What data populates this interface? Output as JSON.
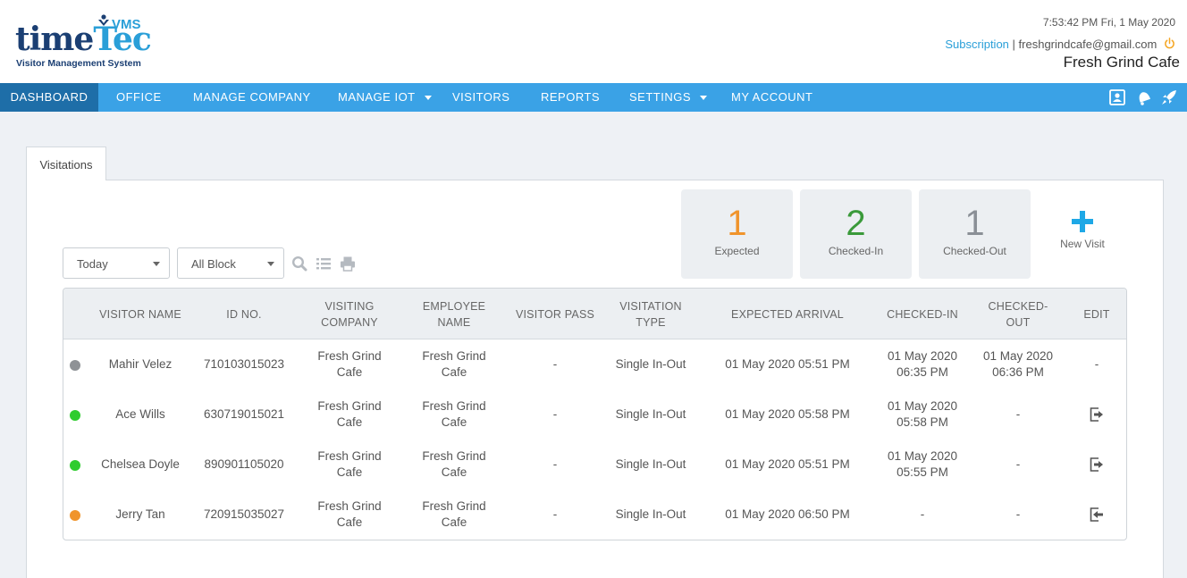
{
  "header": {
    "logo": {
      "time": "time",
      "tec": "Tec",
      "vms": "VMS",
      "subtitle": "Visitor Management System"
    },
    "datetime": "7:53:42 PM  Fri, 1 May 2020",
    "subscription_label": "Subscription",
    "separator": "|",
    "email": "freshgrindcafe@gmail.com",
    "company_name": "Fresh Grind Cafe",
    "power_icon": "power-icon"
  },
  "nav": {
    "items": [
      {
        "label": "DASHBOARD",
        "active": true
      },
      {
        "label": "OFFICE"
      },
      {
        "label": "MANAGE COMPANY"
      },
      {
        "label": "MANAGE IOT",
        "dropdown": true
      },
      {
        "label": "VISITORS"
      },
      {
        "label": "REPORTS"
      },
      {
        "label": "SETTINGS",
        "dropdown": true
      },
      {
        "label": "MY ACCOUNT"
      }
    ],
    "right_icons": [
      "contact-card-icon",
      "bell-icon",
      "rocket-icon"
    ]
  },
  "tab": {
    "label": "Visitations"
  },
  "stats": [
    {
      "value": "1",
      "label": "Expected",
      "color": "#f0942c"
    },
    {
      "value": "2",
      "label": "Checked-In",
      "color": "#3a9a3a"
    },
    {
      "value": "1",
      "label": "Checked-Out",
      "color": "#8a8f96"
    }
  ],
  "new_visit": {
    "label": "New Visit",
    "icon": "plus-icon"
  },
  "filters": {
    "date": "Today",
    "block": "All Block",
    "icons": [
      "search-icon",
      "list-icon",
      "print-icon"
    ]
  },
  "table": {
    "columns": [
      "VISITOR NAME",
      "ID NO.",
      "VISITING COMPANY",
      "EMPLOYEE NAME",
      "VISITOR PASS",
      "VISITATION TYPE",
      "EXPECTED ARRIVAL",
      "CHECKED-IN",
      "CHECKED-OUT",
      "EDIT"
    ],
    "rows": [
      {
        "status_color": "#8f9296",
        "name": "Mahir Velez",
        "id": "710103015023",
        "company": "Fresh Grind Cafe",
        "employee": "Fresh Grind Cafe",
        "pass": "-",
        "type": "Single In-Out",
        "expected": "01 May 2020 05:51 PM",
        "checked_in": "01 May 2020 06:35 PM",
        "checked_out": "01 May 2020 06:36 PM",
        "edit": "-",
        "edit_icon": ""
      },
      {
        "status_color": "#2ecc2e",
        "name": "Ace Wills",
        "id": "630719015021",
        "company": "Fresh Grind Cafe",
        "employee": "Fresh Grind Cafe",
        "pass": "-",
        "type": "Single In-Out",
        "expected": "01 May 2020 05:58 PM",
        "checked_in": "01 May 2020 05:58 PM",
        "checked_out": "-",
        "edit": "",
        "edit_icon": "check-out-icon"
      },
      {
        "status_color": "#2ecc2e",
        "name": "Chelsea Doyle",
        "id": "890901105020",
        "company": "Fresh Grind Cafe",
        "employee": "Fresh Grind Cafe",
        "pass": "-",
        "type": "Single In-Out",
        "expected": "01 May 2020 05:51 PM",
        "checked_in": "01 May 2020 05:55 PM",
        "checked_out": "-",
        "edit": "",
        "edit_icon": "check-out-icon"
      },
      {
        "status_color": "#f0942c",
        "name": "Jerry Tan",
        "id": "720915035027",
        "company": "Fresh Grind Cafe",
        "employee": "Fresh Grind Cafe",
        "pass": "-",
        "type": "Single In-Out",
        "expected": "01 May 2020 06:50 PM",
        "checked_in": "-",
        "checked_out": "-",
        "edit": "",
        "edit_icon": "check-in-icon"
      }
    ]
  }
}
